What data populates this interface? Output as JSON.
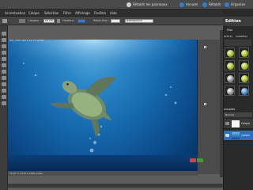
{
  "topbar": {
    "actions": [
      {
        "label": "Rétablir les panneaux",
        "icon": "reset-panels-icon"
      },
      {
        "label": "Annuler",
        "icon": "undo-icon"
      },
      {
        "label": "Rétablir",
        "icon": "redo-icon"
      },
      {
        "label": "Organise",
        "icon": "organizer-icon"
      }
    ]
  },
  "menubar": {
    "items": [
      "Accentuation",
      "Calque",
      "Sélection",
      "Filtre",
      "Affichage",
      "Fenêtre",
      "Aide"
    ]
  },
  "options": {
    "width_label": "Largeur :",
    "width_value": "56 cm",
    "height_label": "Hauteur :",
    "resolution_label": "Résolution :",
    "dropdown_value": "pixels/pouce"
  },
  "document": {
    "tab_text": "IMG_0063.JPG à 16,7% (RVB/8)",
    "status_text": "16,67 %  1315 x 2000 pixels"
  },
  "panel": {
    "title": "Edition",
    "mode_tab": "Mise",
    "tabs": [
      "EFFETS",
      "CONTENU"
    ],
    "layers_header": "CALQUES",
    "layers_mode": "Normal",
    "layers": [
      {
        "name": "Calque",
        "badge": "lisible"
      },
      {
        "name": "Calque"
      }
    ]
  },
  "colors": {
    "accent_green": "#3f9c35",
    "blue_icon": "#2d7fd2",
    "panel_bg": "#2a2a2a"
  }
}
